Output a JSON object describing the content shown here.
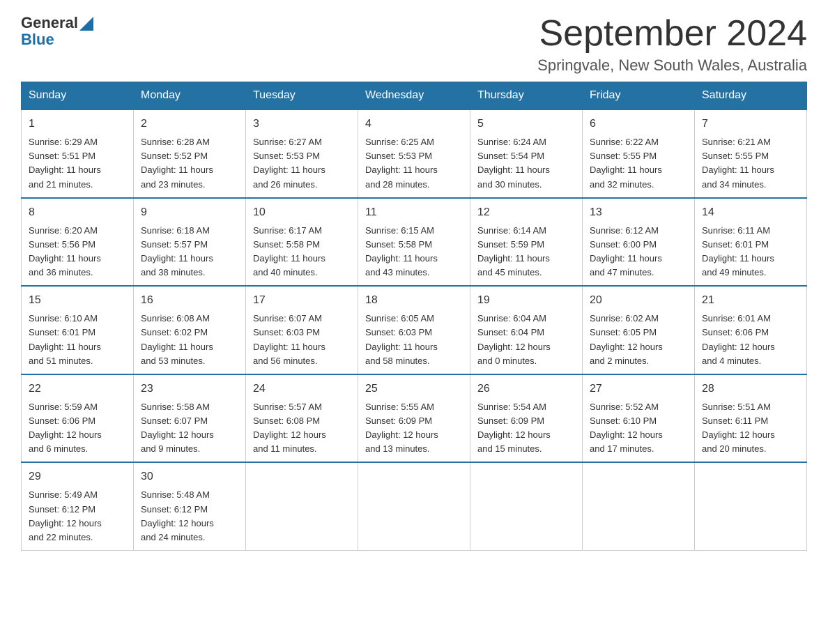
{
  "header": {
    "logo_general": "General",
    "logo_blue": "Blue",
    "month_year": "September 2024",
    "location": "Springvale, New South Wales, Australia"
  },
  "weekdays": [
    "Sunday",
    "Monday",
    "Tuesday",
    "Wednesday",
    "Thursday",
    "Friday",
    "Saturday"
  ],
  "weeks": [
    [
      {
        "day": "1",
        "sunrise": "6:29 AM",
        "sunset": "5:51 PM",
        "daylight": "11 hours and 21 minutes."
      },
      {
        "day": "2",
        "sunrise": "6:28 AM",
        "sunset": "5:52 PM",
        "daylight": "11 hours and 23 minutes."
      },
      {
        "day": "3",
        "sunrise": "6:27 AM",
        "sunset": "5:53 PM",
        "daylight": "11 hours and 26 minutes."
      },
      {
        "day": "4",
        "sunrise": "6:25 AM",
        "sunset": "5:53 PM",
        "daylight": "11 hours and 28 minutes."
      },
      {
        "day": "5",
        "sunrise": "6:24 AM",
        "sunset": "5:54 PM",
        "daylight": "11 hours and 30 minutes."
      },
      {
        "day": "6",
        "sunrise": "6:22 AM",
        "sunset": "5:55 PM",
        "daylight": "11 hours and 32 minutes."
      },
      {
        "day": "7",
        "sunrise": "6:21 AM",
        "sunset": "5:55 PM",
        "daylight": "11 hours and 34 minutes."
      }
    ],
    [
      {
        "day": "8",
        "sunrise": "6:20 AM",
        "sunset": "5:56 PM",
        "daylight": "11 hours and 36 minutes."
      },
      {
        "day": "9",
        "sunrise": "6:18 AM",
        "sunset": "5:57 PM",
        "daylight": "11 hours and 38 minutes."
      },
      {
        "day": "10",
        "sunrise": "6:17 AM",
        "sunset": "5:58 PM",
        "daylight": "11 hours and 40 minutes."
      },
      {
        "day": "11",
        "sunrise": "6:15 AM",
        "sunset": "5:58 PM",
        "daylight": "11 hours and 43 minutes."
      },
      {
        "day": "12",
        "sunrise": "6:14 AM",
        "sunset": "5:59 PM",
        "daylight": "11 hours and 45 minutes."
      },
      {
        "day": "13",
        "sunrise": "6:12 AM",
        "sunset": "6:00 PM",
        "daylight": "11 hours and 47 minutes."
      },
      {
        "day": "14",
        "sunrise": "6:11 AM",
        "sunset": "6:01 PM",
        "daylight": "11 hours and 49 minutes."
      }
    ],
    [
      {
        "day": "15",
        "sunrise": "6:10 AM",
        "sunset": "6:01 PM",
        "daylight": "11 hours and 51 minutes."
      },
      {
        "day": "16",
        "sunrise": "6:08 AM",
        "sunset": "6:02 PM",
        "daylight": "11 hours and 53 minutes."
      },
      {
        "day": "17",
        "sunrise": "6:07 AM",
        "sunset": "6:03 PM",
        "daylight": "11 hours and 56 minutes."
      },
      {
        "day": "18",
        "sunrise": "6:05 AM",
        "sunset": "6:03 PM",
        "daylight": "11 hours and 58 minutes."
      },
      {
        "day": "19",
        "sunrise": "6:04 AM",
        "sunset": "6:04 PM",
        "daylight": "12 hours and 0 minutes."
      },
      {
        "day": "20",
        "sunrise": "6:02 AM",
        "sunset": "6:05 PM",
        "daylight": "12 hours and 2 minutes."
      },
      {
        "day": "21",
        "sunrise": "6:01 AM",
        "sunset": "6:06 PM",
        "daylight": "12 hours and 4 minutes."
      }
    ],
    [
      {
        "day": "22",
        "sunrise": "5:59 AM",
        "sunset": "6:06 PM",
        "daylight": "12 hours and 6 minutes."
      },
      {
        "day": "23",
        "sunrise": "5:58 AM",
        "sunset": "6:07 PM",
        "daylight": "12 hours and 9 minutes."
      },
      {
        "day": "24",
        "sunrise": "5:57 AM",
        "sunset": "6:08 PM",
        "daylight": "12 hours and 11 minutes."
      },
      {
        "day": "25",
        "sunrise": "5:55 AM",
        "sunset": "6:09 PM",
        "daylight": "12 hours and 13 minutes."
      },
      {
        "day": "26",
        "sunrise": "5:54 AM",
        "sunset": "6:09 PM",
        "daylight": "12 hours and 15 minutes."
      },
      {
        "day": "27",
        "sunrise": "5:52 AM",
        "sunset": "6:10 PM",
        "daylight": "12 hours and 17 minutes."
      },
      {
        "day": "28",
        "sunrise": "5:51 AM",
        "sunset": "6:11 PM",
        "daylight": "12 hours and 20 minutes."
      }
    ],
    [
      {
        "day": "29",
        "sunrise": "5:49 AM",
        "sunset": "6:12 PM",
        "daylight": "12 hours and 22 minutes."
      },
      {
        "day": "30",
        "sunrise": "5:48 AM",
        "sunset": "6:12 PM",
        "daylight": "12 hours and 24 minutes."
      },
      null,
      null,
      null,
      null,
      null
    ]
  ]
}
